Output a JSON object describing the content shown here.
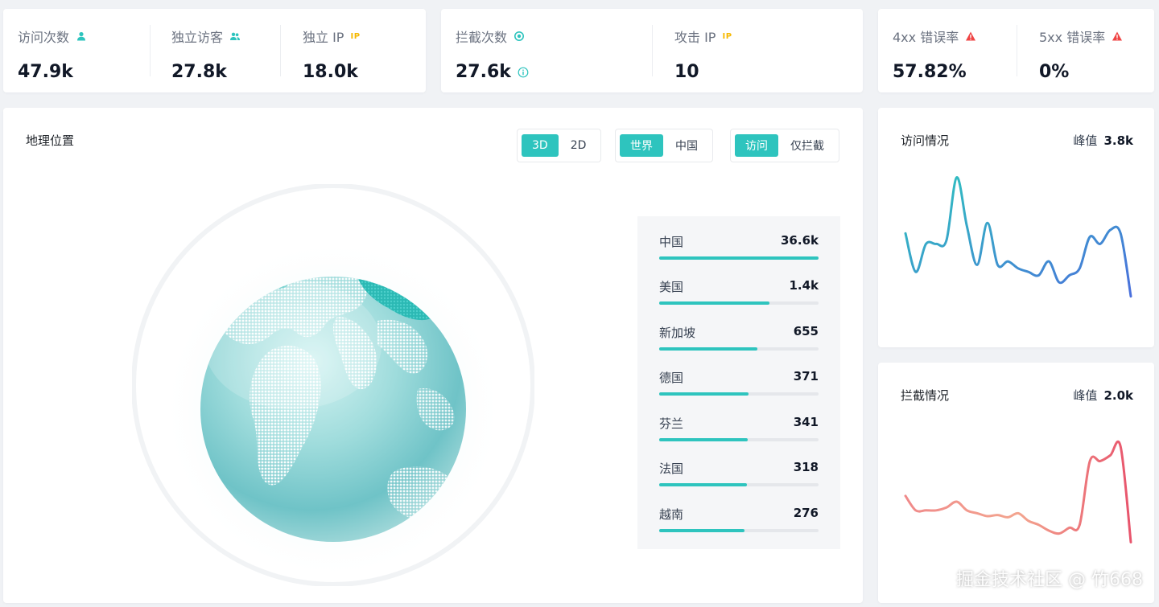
{
  "stats": {
    "visit_count": {
      "label": "访问次数",
      "value": "47.9k"
    },
    "unique_visitors": {
      "label": "独立访客",
      "value": "27.8k"
    },
    "unique_ip": {
      "label": "独立 IP",
      "badge": "IP",
      "value": "18.0k"
    },
    "block_count": {
      "label": "拦截次数",
      "value": "27.6k"
    },
    "attack_ip": {
      "label": "攻击 IP",
      "badge": "IP",
      "value": "10"
    },
    "rate_4xx": {
      "label": "4xx 错误率",
      "value": "57.82%"
    },
    "rate_5xx": {
      "label": "5xx 错误率",
      "value": "0%"
    }
  },
  "geo": {
    "title": "地理位置",
    "view_toggle": {
      "options": [
        "3D",
        "2D"
      ],
      "selected": "3D"
    },
    "region_toggle": {
      "options": [
        "世界",
        "中国"
      ],
      "selected": "世界"
    },
    "metric_toggle": {
      "options": [
        "访问",
        "仅拦截"
      ],
      "selected": "访问"
    },
    "ranking": [
      {
        "name": "中国",
        "value": "36.6k",
        "ratio": 1.0
      },
      {
        "name": "美国",
        "value": "1.4k",
        "ratio": 0.69
      },
      {
        "name": "新加坡",
        "value": "655",
        "ratio": 0.615
      },
      {
        "name": "德国",
        "value": "371",
        "ratio": 0.56
      },
      {
        "name": "芬兰",
        "value": "341",
        "ratio": 0.555
      },
      {
        "name": "法国",
        "value": "318",
        "ratio": 0.55
      },
      {
        "name": "越南",
        "value": "276",
        "ratio": 0.535
      }
    ]
  },
  "visit_trend": {
    "title": "访问情况",
    "peak_label": "峰值",
    "peak_value": "3.8k"
  },
  "block_trend": {
    "title": "拦截情况",
    "peak_label": "峰值",
    "peak_value": "2.0k"
  },
  "chart_data": [
    {
      "type": "line",
      "title": "访问情况",
      "y": [
        2.2,
        1.1,
        1.9,
        1.9,
        2.0,
        3.8,
        2.4,
        1.3,
        2.5,
        1.3,
        1.4,
        1.2,
        1.1,
        1.0,
        1.4,
        0.8,
        1.0,
        1.2,
        2.1,
        1.9,
        2.3,
        2.2,
        0.4
      ],
      "ylim": [
        0,
        4
      ]
    },
    {
      "type": "line",
      "title": "拦截情况",
      "y": [
        0.85,
        0.6,
        0.6,
        0.6,
        0.65,
        0.75,
        0.6,
        0.55,
        0.5,
        0.52,
        0.48,
        0.55,
        0.42,
        0.35,
        0.25,
        0.2,
        0.3,
        0.35,
        1.45,
        1.45,
        1.55,
        1.7,
        0.05
      ],
      "ylim": [
        0,
        2
      ]
    }
  ],
  "watermark": "掘金技术社区 @ 竹668",
  "colors": {
    "accent": "#2ec4be",
    "warning": "#f5b800",
    "danger": "#ef4444",
    "visit_line_start": "#2ec4be",
    "visit_line_end": "#4a6fdc",
    "block_line_start": "#f07a7a",
    "block_line_end": "#e8546c"
  }
}
